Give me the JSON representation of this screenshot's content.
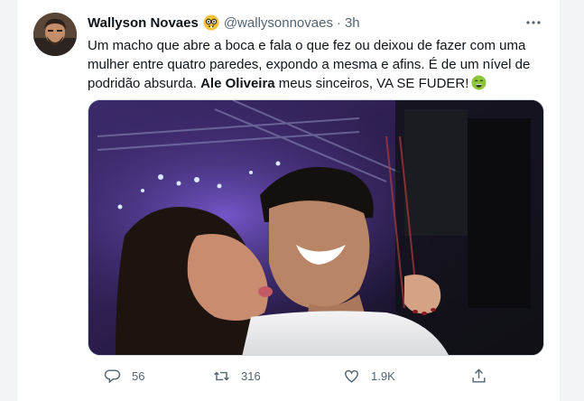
{
  "tweet": {
    "display_name": "Wallyson Novaes",
    "name_emoji": "nerd-face-emoji",
    "handle": "@wallysonnovaes",
    "separator": "·",
    "time": "3h",
    "text_line1": "Um macho que abre a boca e fala o que fez ou deixou de fazer com uma",
    "text_line2": "mulher entre quatro paredes, expondo a mesma e afins. É de um nível de",
    "text_line3_a": "podridão absurda. ",
    "text_mention": "Ale Oliveira",
    "text_line3_b": " meus sinceiros, VA SE FUDER!",
    "end_emoji": "nauseated-face-emoji",
    "media": {
      "description_icon": "photo"
    }
  },
  "actions": {
    "replies": "56",
    "retweets": "316",
    "likes": "1.9K"
  },
  "colors": {
    "text": "#0f1419",
    "secondary": "#536471",
    "border": "#cfd9de"
  },
  "icons": {
    "more": "more-dots-icon",
    "reply": "reply-icon",
    "retweet": "retweet-icon",
    "like": "heart-icon",
    "share": "share-icon"
  }
}
